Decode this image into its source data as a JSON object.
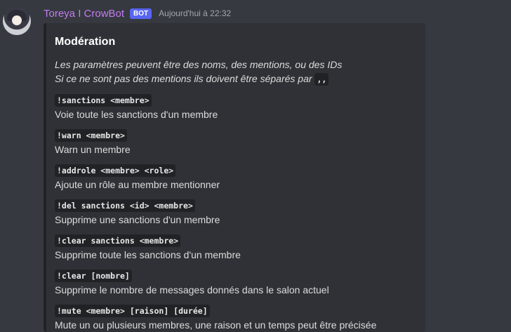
{
  "message": {
    "username": "Toreya I CrowBot",
    "bot_tag": "BOT",
    "timestamp": "Aujourd'hui à 22:32"
  },
  "embed": {
    "title": "Modération",
    "description_line1": "Les paramètres peuvent être des noms, des mentions, ou des IDs",
    "description_line2": "Si ce ne sont pas des mentions ils doivent être séparés par",
    "separator_code": ",,",
    "commands": [
      {
        "name": "!sanctions <membre>",
        "desc": "Voie toute les sanctions d'un membre"
      },
      {
        "name": "!warn <membre>",
        "desc": "Warn un membre"
      },
      {
        "name": "!addrole <membre> <role>",
        "desc": "Ajoute un rôle au membre mentionner"
      },
      {
        "name": "!del sanctions <id> <membre>",
        "desc": "Supprime une sanctions d'un membre"
      },
      {
        "name": "!clear sanctions <membre>",
        "desc": "Supprime toute les sanctions d'un membre"
      },
      {
        "name": "!clear [nombre]",
        "desc": "Supprime le nombre de messages donnés dans le salon actuel"
      },
      {
        "name": "!mute <membre> [raison] [durée]",
        "desc": "Mute un ou plusieurs membres, une raison et un temps peut être précisée"
      }
    ]
  },
  "colors": {
    "background": "#36393f",
    "embed_bg": "#2f3136",
    "username": "#c27cf0",
    "bot_tag": "#5865f2"
  }
}
